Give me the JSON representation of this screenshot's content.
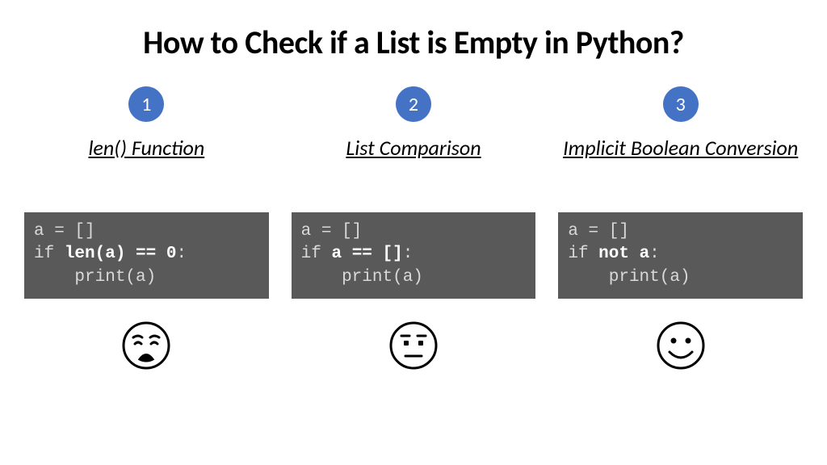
{
  "title": "How to Check if a List is Empty in Python?",
  "colors": {
    "accent": "#4472c4",
    "code_bg": "#595959",
    "code_text": "#d9d9d9"
  },
  "methods": [
    {
      "badge": "1",
      "subtitle": "len() Function",
      "code_line1_a": "a = []",
      "code_line2_pre": "if ",
      "code_line2_bold": "len(a) == 0",
      "code_line2_post": ":",
      "code_line3": "    print(a)",
      "reaction": "weary-face-icon"
    },
    {
      "badge": "2",
      "subtitle": "List Comparison",
      "code_line1_a": "a = []",
      "code_line2_pre": "if ",
      "code_line2_bold": "a == []",
      "code_line2_post": ":",
      "code_line3": "    print(a)",
      "reaction": "neutral-face-icon"
    },
    {
      "badge": "3",
      "subtitle": "Implicit Boolean Conversion",
      "code_line1_a": "a = []",
      "code_line2_pre": "if ",
      "code_line2_bold": "not a",
      "code_line2_post": ":",
      "code_line3": "    print(a)",
      "reaction": "smiling-face-icon"
    }
  ]
}
